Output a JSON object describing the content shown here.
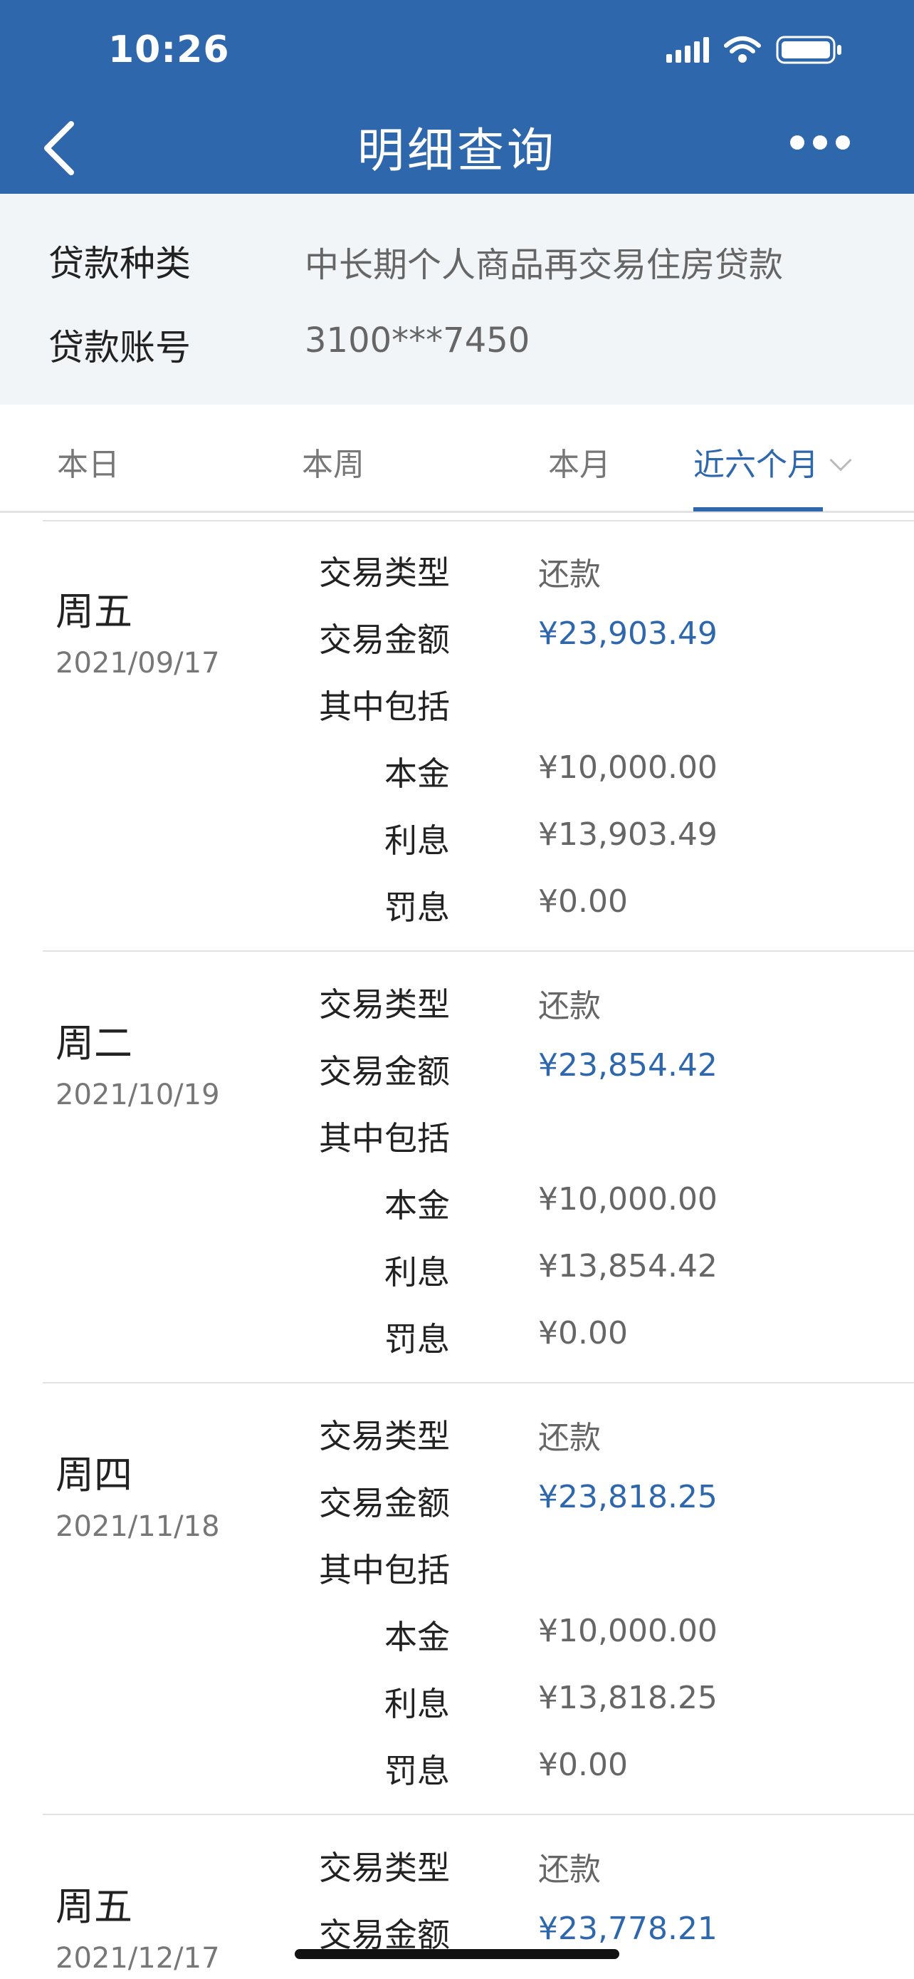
{
  "status": {
    "time": "10:26"
  },
  "nav": {
    "title": "明细查询"
  },
  "loan": {
    "type_label": "贷款种类",
    "type_value": "中长期个人商品再交易住房贷款",
    "account_label": "贷款账号",
    "account_value": "3100***7450"
  },
  "tabs": [
    {
      "label": "本日"
    },
    {
      "label": "本周"
    },
    {
      "label": "本月"
    },
    {
      "label": "近六个月"
    }
  ],
  "labels": {
    "type": "交易类型",
    "amount": "交易金额",
    "includes": "其中包括",
    "principal": "本金",
    "interest": "利息",
    "penalty": "罚息"
  },
  "records": [
    {
      "weekday": "周五",
      "date": "2021/09/17",
      "type": "还款",
      "amount": "¥23,903.49",
      "principal": "¥10,000.00",
      "interest": "¥13,903.49",
      "penalty": "¥0.00"
    },
    {
      "weekday": "周二",
      "date": "2021/10/19",
      "type": "还款",
      "amount": "¥23,854.42",
      "principal": "¥10,000.00",
      "interest": "¥13,854.42",
      "penalty": "¥0.00"
    },
    {
      "weekday": "周四",
      "date": "2021/11/18",
      "type": "还款",
      "amount": "¥23,818.25",
      "principal": "¥10,000.00",
      "interest": "¥13,818.25",
      "penalty": "¥0.00"
    },
    {
      "weekday": "周五",
      "date": "2021/12/17",
      "type": "还款",
      "amount": "¥23,778.21"
    }
  ],
  "colors": {
    "brand": "#2f67ad",
    "info_bg": "#f2f5f8"
  }
}
